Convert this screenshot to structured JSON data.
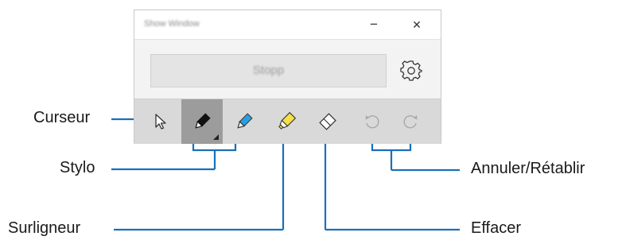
{
  "window": {
    "title": "Show Window",
    "minimize_glyph": "−",
    "close_glyph": "✕",
    "stop_label": "Stopp",
    "settings_icon": "gear-icon"
  },
  "toolbar": {
    "tools": [
      {
        "name": "cursor-tool",
        "icon": "arrow-cursor-icon"
      },
      {
        "name": "pen-black-tool",
        "icon": "pen-icon",
        "color": "#111111",
        "active": true
      },
      {
        "name": "pen-blue-tool",
        "icon": "pen-icon",
        "color": "#2a9fe0"
      },
      {
        "name": "highlighter-tool",
        "icon": "highlighter-icon",
        "color": "#f5e04a"
      },
      {
        "name": "eraser-tool",
        "icon": "eraser-icon"
      },
      {
        "name": "undo-tool",
        "icon": "undo-icon"
      },
      {
        "name": "redo-tool",
        "icon": "redo-icon"
      }
    ]
  },
  "callouts": {
    "cursor": "Curseur",
    "pen": "Stylo",
    "highlighter": "Surligneur",
    "eraser": "Effacer",
    "undo_redo": "Annuler/Rétablir"
  },
  "colors": {
    "leader_line": "#1c6fb8",
    "active_tool_bg": "#9c9c9c",
    "toolbar_bg": "#d9d9d9"
  }
}
